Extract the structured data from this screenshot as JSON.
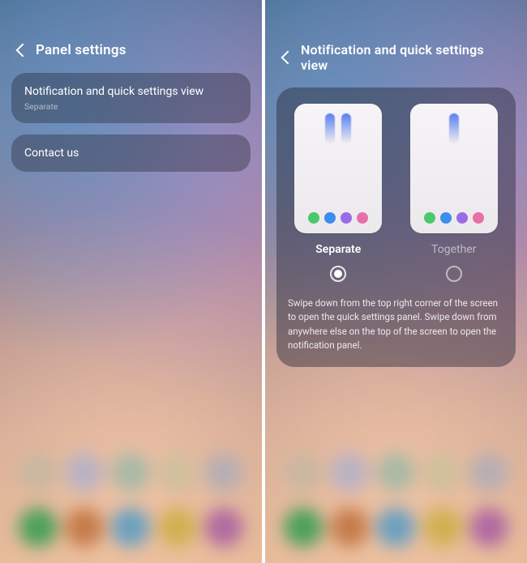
{
  "left": {
    "title": "Panel settings",
    "rows": [
      {
        "title": "Notification and quick settings view",
        "sub": "Separate"
      },
      {
        "title": "Contact us",
        "sub": ""
      }
    ]
  },
  "right": {
    "title": "Notification and quick settings view",
    "options": {
      "separate": "Separate",
      "together": "Together",
      "selected": "separate"
    },
    "description": "Swipe down from the top right corner of the screen to open the quick settings panel. Swipe down from anywhere else on the top of the screen to open the notification panel."
  },
  "dock_colors": {
    "row1": [
      "#c9b7a0",
      "#b9b2c4",
      "#a8b9a6",
      "#cfbf9c",
      "#b6aeb2"
    ],
    "row2": [
      "#4aa05a",
      "#c57b4a",
      "#6aa0c0",
      "#d0b050",
      "#b06aa0"
    ]
  }
}
